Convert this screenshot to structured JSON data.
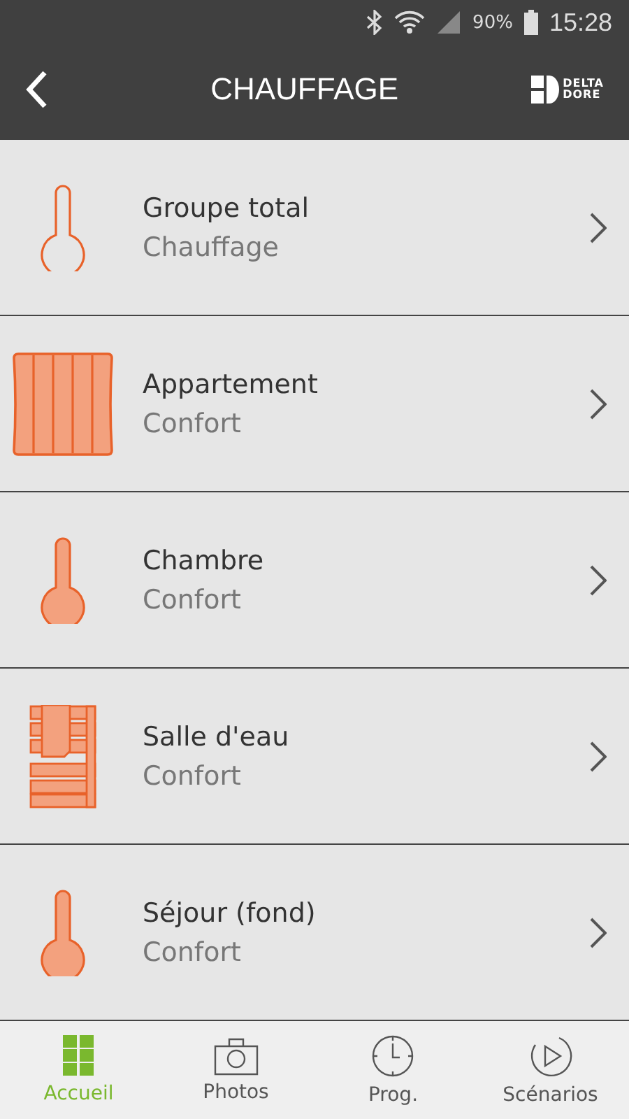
{
  "status_bar": {
    "battery": "90%",
    "time": "15:28"
  },
  "header": {
    "title": "CHAUFFAGE",
    "logo": [
      "DELTA",
      "DORE"
    ]
  },
  "zones": [
    {
      "kind": "thermometer-outline",
      "name": "Groupe total",
      "mode": "Chauffage"
    },
    {
      "kind": "radiator",
      "name": "Appartement",
      "mode": "Confort"
    },
    {
      "kind": "thermometer",
      "name": "Chambre",
      "mode": "Confort"
    },
    {
      "kind": "towel-radiator",
      "name": "Salle d'eau",
      "mode": "Confort"
    },
    {
      "kind": "thermometer",
      "name": "Séjour (fond)",
      "mode": "Confort"
    }
  ],
  "bottom_nav": [
    {
      "kind": "home",
      "label": "Accueil",
      "selected": true
    },
    {
      "kind": "photos",
      "label": "Photos",
      "selected": false
    },
    {
      "kind": "prog",
      "label": "Prog.",
      "selected": false
    },
    {
      "kind": "scenarios",
      "label": "Scénarios",
      "selected": false
    }
  ]
}
